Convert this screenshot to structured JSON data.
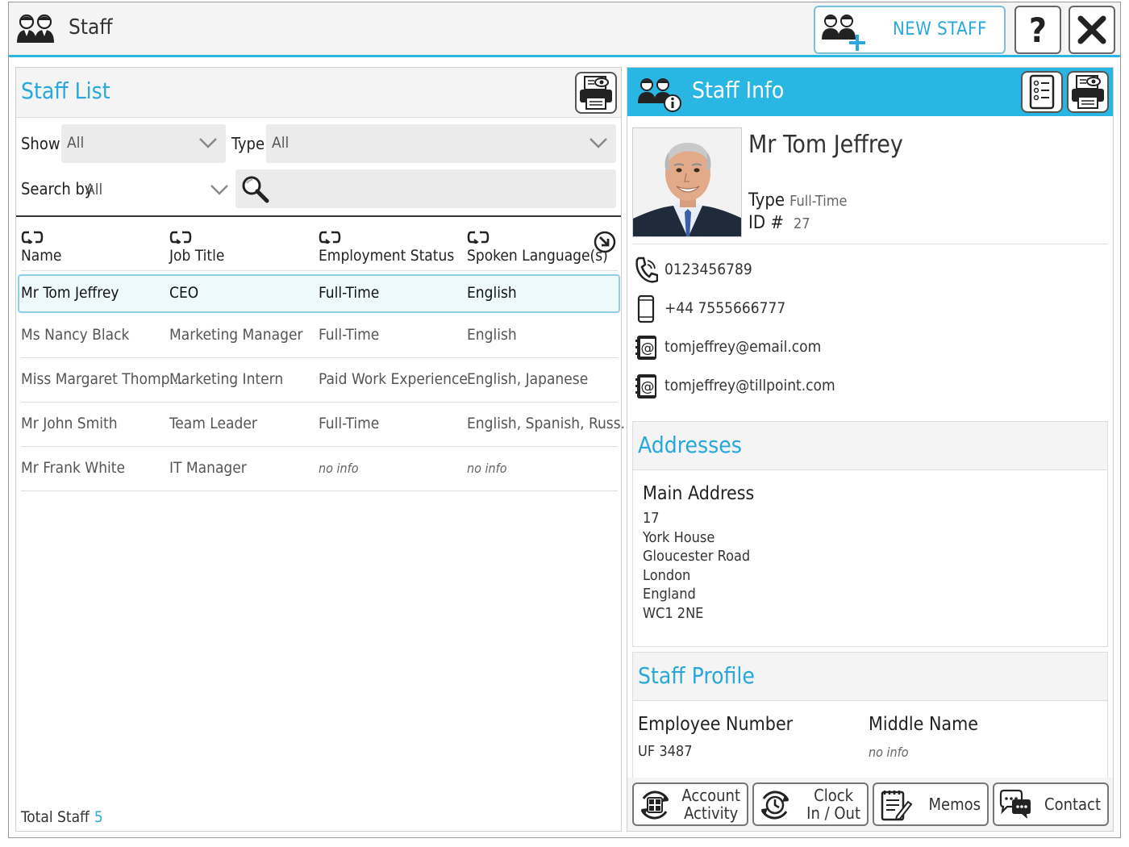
{
  "titlebar": {
    "title": "Staff",
    "new_staff_label": "NEW STAFF",
    "help_label": "?",
    "icons": [
      "staff-icon",
      "add-staff-icon",
      "help-icon",
      "close-icon"
    ]
  },
  "staff_list": {
    "title": "Staff List",
    "filters": {
      "show_label": "Show",
      "show_value": "All",
      "type_label": "Type",
      "type_value": "All",
      "search_by_label": "Search by",
      "search_by_value": "All",
      "search_value": ""
    },
    "columns": [
      "Name",
      "Job Title",
      "Employment Status",
      "Spoken Language(s)"
    ],
    "rows": [
      {
        "name": "Mr Tom Jeffrey",
        "job": "CEO",
        "status": "Full-Time",
        "lang": "English",
        "selected": true
      },
      {
        "name": "Ms Nancy Black",
        "job": "Marketing Manager",
        "status": "Full-Time",
        "lang": "English"
      },
      {
        "name": "Miss Margaret Thomp...",
        "job": "Marketing Intern",
        "status": "Paid Work Experience",
        "lang": "English, Japanese"
      },
      {
        "name": "Mr John Smith",
        "job": "Team Leader",
        "status": "Full-Time",
        "lang": "English, Spanish, Russ..."
      },
      {
        "name": "Mr Frank White",
        "job": "IT Manager",
        "status": "no info",
        "lang": "no info"
      }
    ],
    "footer_label": "Total Staff",
    "footer_count": "5"
  },
  "staff_info": {
    "title": "Staff Info",
    "name": "Mr Tom Jeffrey",
    "type_label": "Type",
    "type_value": "Full-Time",
    "id_label": "ID #",
    "id_value": "27",
    "phone": "0123456789",
    "mobile": "+44 7555666777",
    "email1": "tomjeffrey@email.com",
    "email2": "tomjeffrey@tillpoint.com",
    "addresses": {
      "title": "Addresses",
      "main_title": "Main Address",
      "lines": [
        "17",
        "York House",
        "Gloucester Road",
        "London",
        "England",
        "WC1 2NE"
      ]
    },
    "profile": {
      "title": "Staff Profile",
      "employee_number_label": "Employee Number",
      "employee_number_value": "UF 3487",
      "middle_name_label": "Middle Name",
      "middle_name_value": "no info"
    },
    "actions": {
      "account_activity_1": "Account",
      "account_activity_2": "Activity",
      "clock_1": "Clock",
      "clock_2": "In / Out",
      "memos": "Memos",
      "contact": "Contact"
    }
  },
  "colors": {
    "accent": "#29b6e3",
    "accent_text": "#29a8dc",
    "selection_bg": "#eef9fd",
    "selection_border": "#8fd0e8",
    "panel_header_bg": "#f4f4f4"
  }
}
